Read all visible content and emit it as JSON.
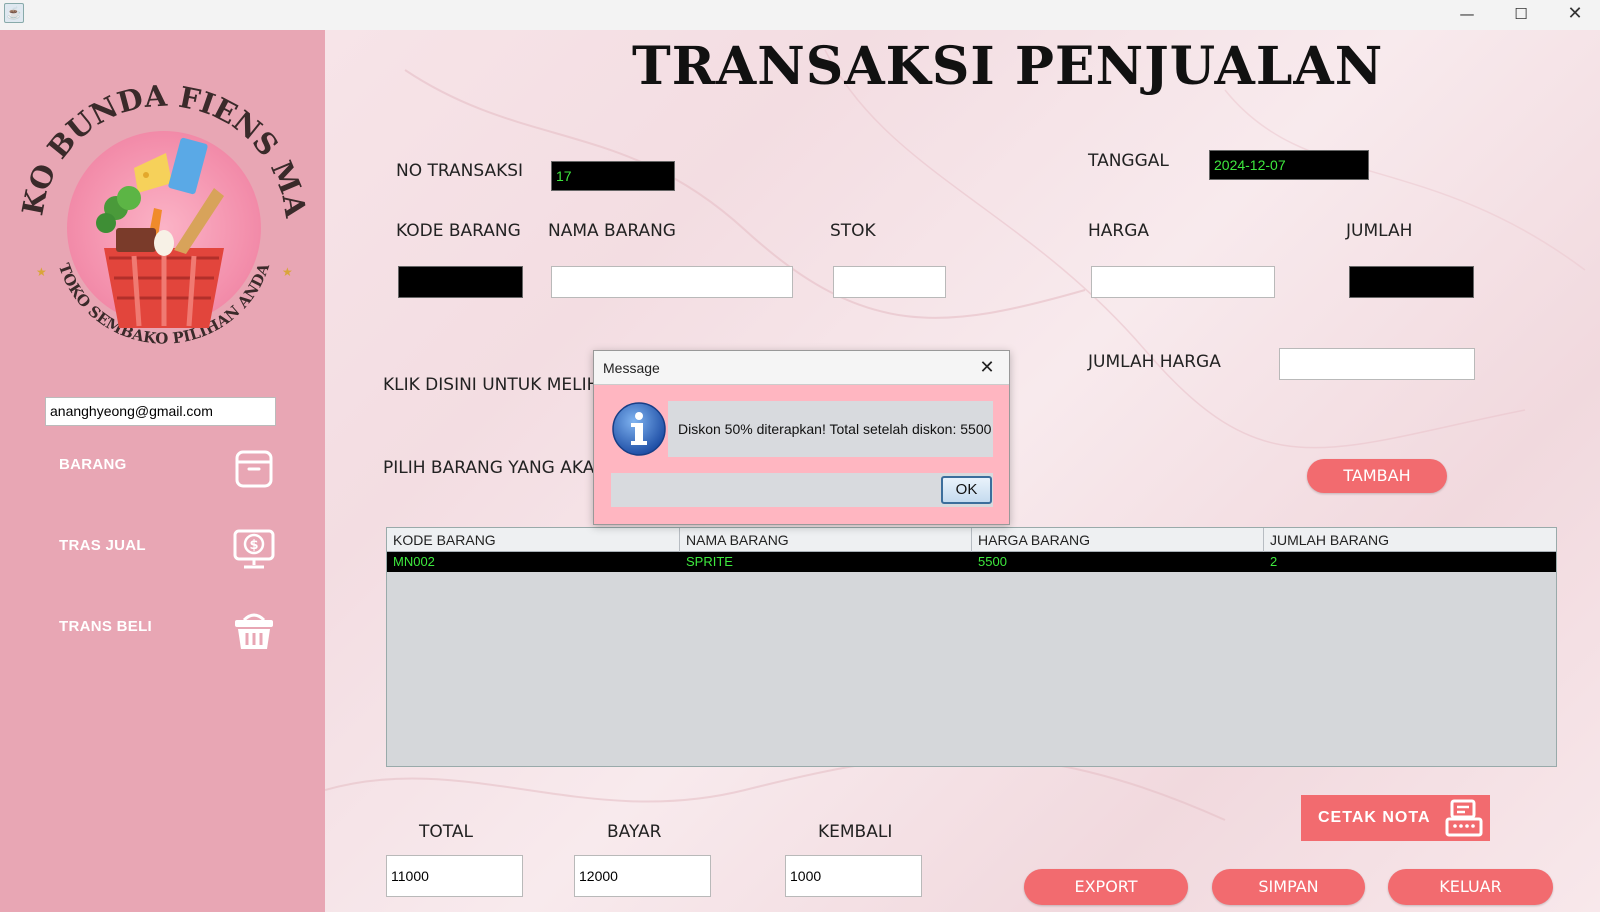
{
  "window": {
    "minimize_glyph": "—",
    "maximize_glyph": "☐",
    "close_glyph": "✕"
  },
  "sidebar": {
    "logo": {
      "arc_top": "TOKO BUNDA FIENS MART",
      "arc_bottom": "TOKO SEMBAKO PILIHAN ANDA"
    },
    "email": "ananghyeong@gmail.com",
    "items": [
      {
        "label": "BARANG",
        "icon": "archive-box-icon"
      },
      {
        "label": "TRAS JUAL",
        "icon": "money-monitor-icon"
      },
      {
        "label": "TRANS BELI",
        "icon": "basket-icon"
      }
    ]
  },
  "main": {
    "title": "TRANSAKSI PENJUALAN",
    "labels": {
      "no_transaksi": "NO TRANSAKSI",
      "tanggal": "TANGGAL",
      "kode_barang": "KODE BARANG",
      "nama_barang": "NAMA BARANG",
      "stok": "STOK",
      "harga": "HARGA",
      "jumlah": "JUMLAH",
      "jumlah_harga": "JUMLAH HARGA",
      "klik_disini": "KLIK DISINI UNTUK MELIHA",
      "pilih_barang": "PILIH BARANG YANG AKAN",
      "total": "TOTAL",
      "bayar": "BAYAR",
      "kembali": "KEMBALI"
    },
    "fields": {
      "no_transaksi": "17",
      "tanggal": "2024-12-07",
      "kode_barang": "",
      "nama_barang": "",
      "stok": "",
      "harga": "",
      "jumlah": "",
      "jumlah_harga": "",
      "total": "11000",
      "bayar": "12000",
      "kembali": "1000"
    },
    "buttons": {
      "tambah": "TAMBAH",
      "cetak_nota": "CETAK NOTA",
      "export": "EXPORT",
      "simpan": "SIMPAN",
      "keluar": "KELUAR"
    },
    "table": {
      "columns": [
        "KODE BARANG",
        "NAMA BARANG",
        "HARGA BARANG",
        "JUMLAH BARANG"
      ],
      "rows": [
        [
          "MN002",
          "SPRITE",
          "5500",
          "2"
        ]
      ]
    }
  },
  "dialog": {
    "title": "Message",
    "message": "Diskon 50% diterapkan! Total setelah diskon: 5500",
    "ok_label": "OK"
  },
  "colors": {
    "sidebar_bg": "#e8a6b4",
    "accent_button": "#f26b6f",
    "dark_field_text": "#3ee83e",
    "dialog_bg": "#ffb6c1"
  }
}
